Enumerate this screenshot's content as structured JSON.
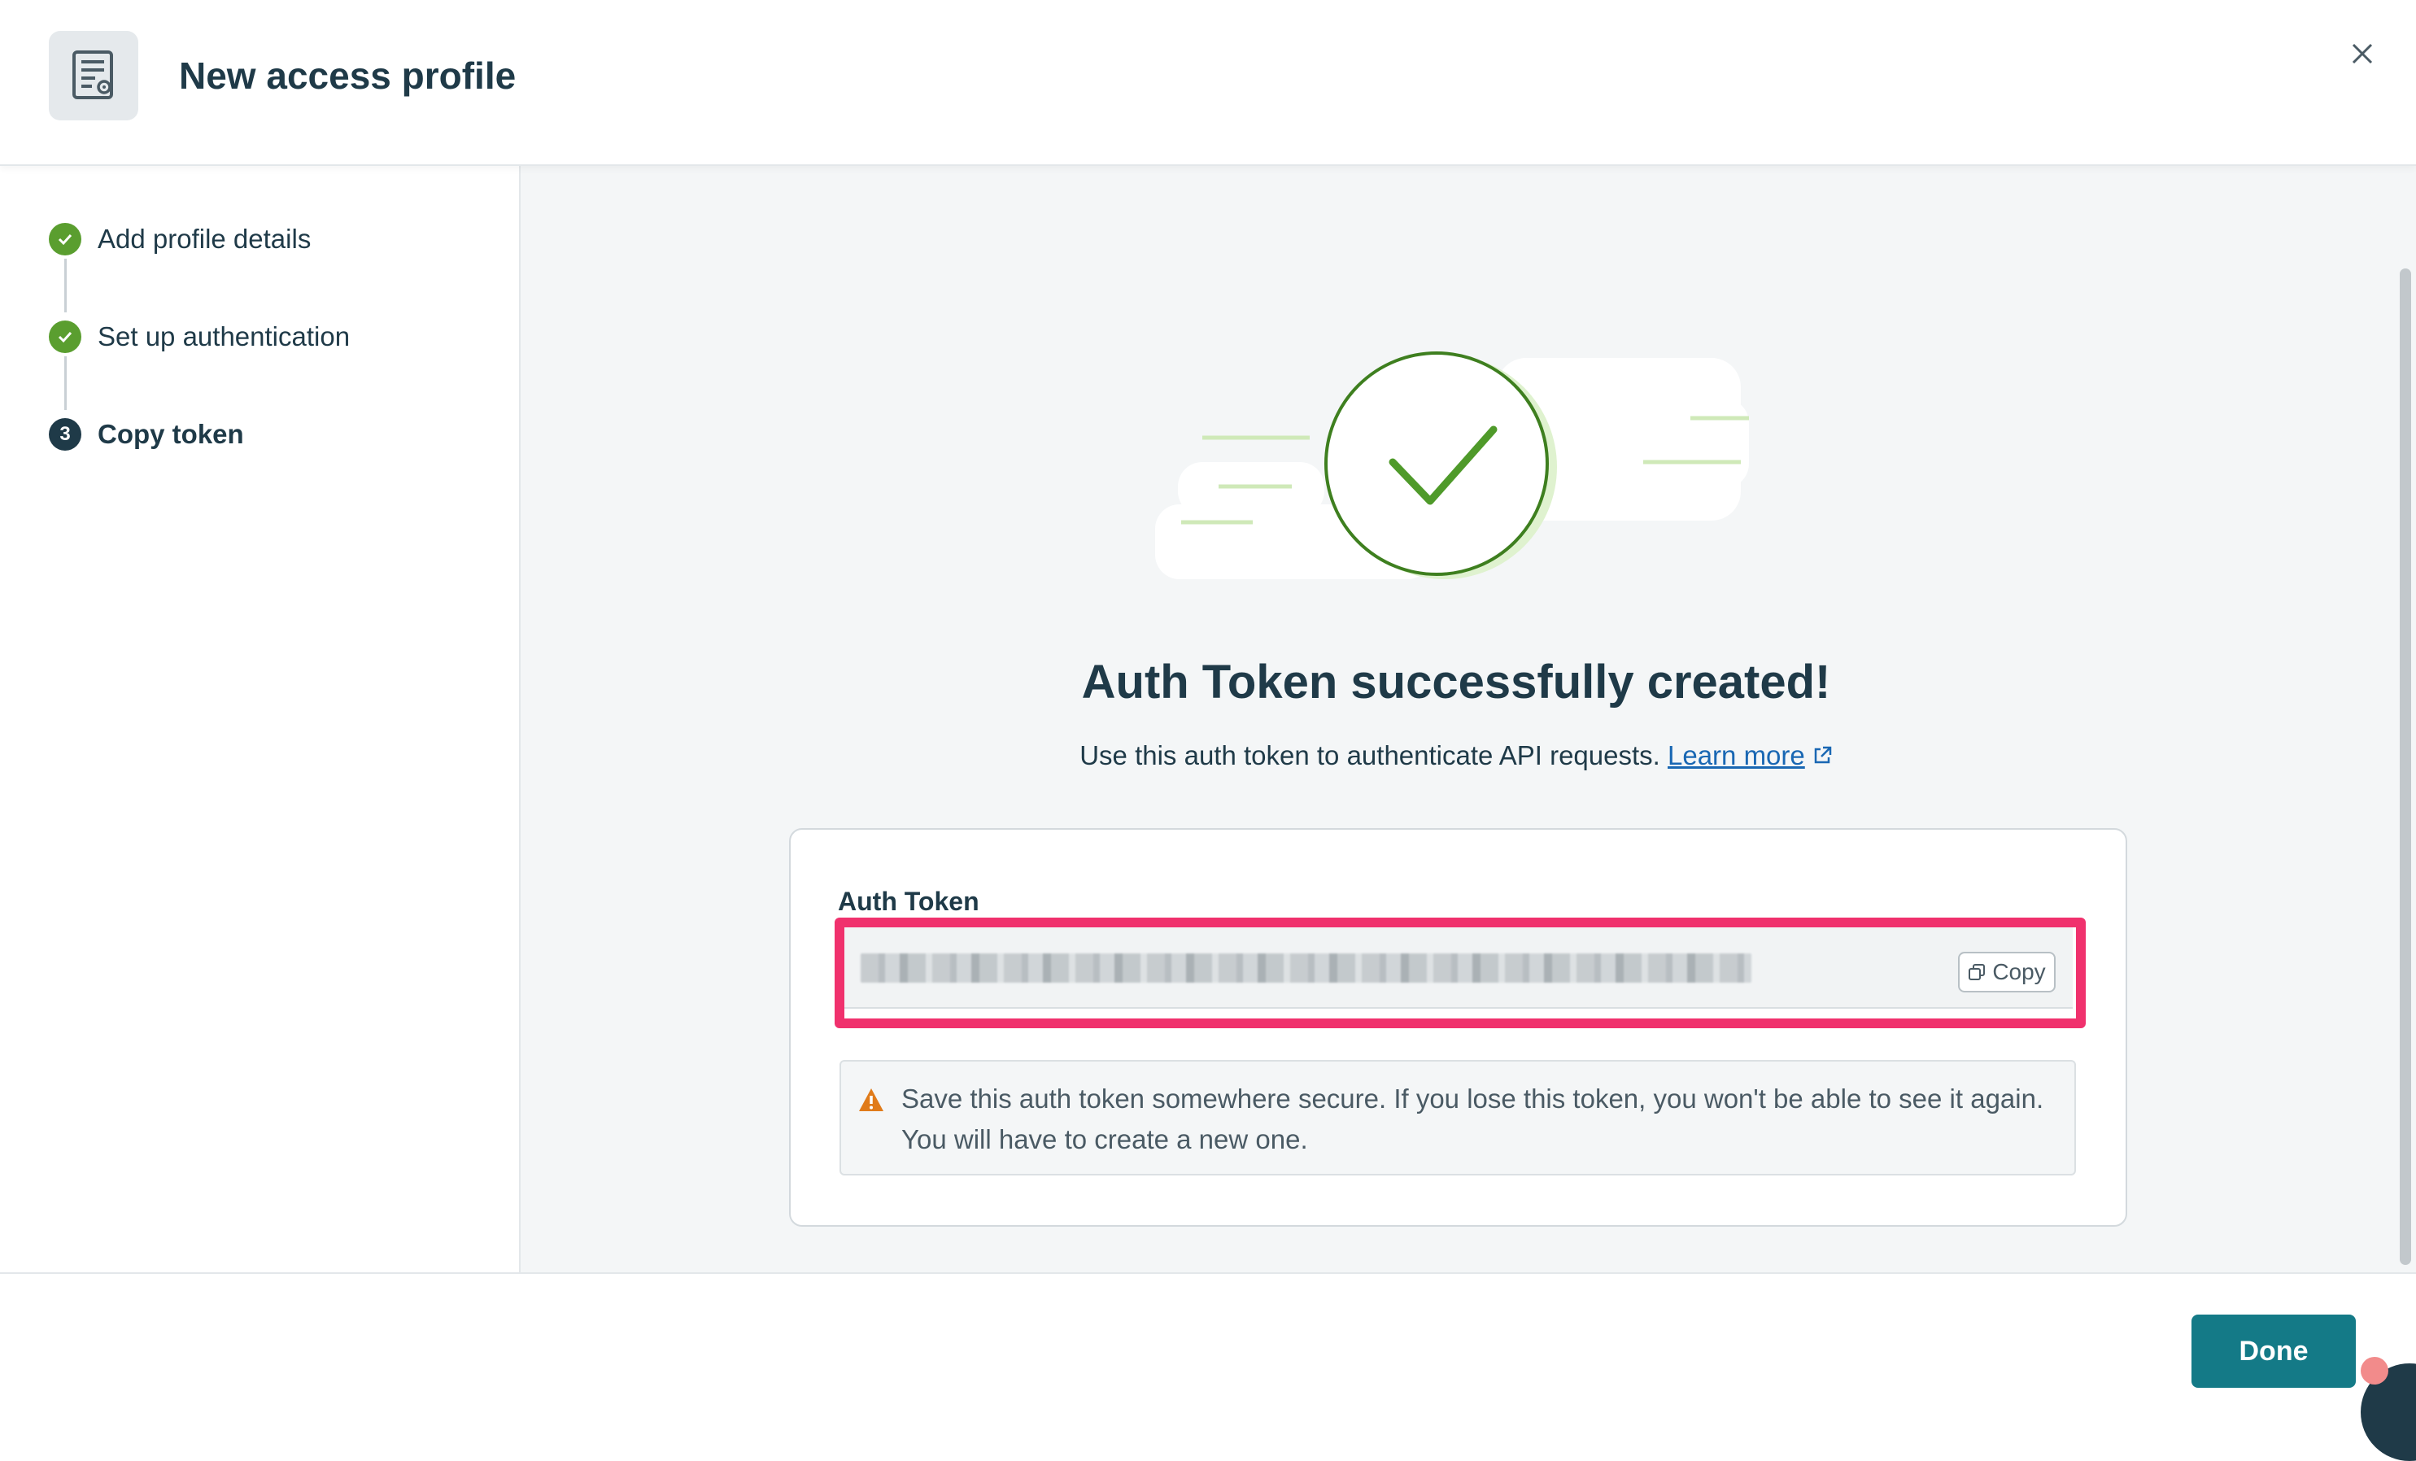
{
  "header": {
    "title": "New access profile",
    "icon": "profile-document-icon",
    "close_icon": "close-icon"
  },
  "steps": [
    {
      "label": "Add profile details",
      "status": "done",
      "marker": ""
    },
    {
      "label": "Set up authentication",
      "status": "done",
      "marker": ""
    },
    {
      "label": "Copy token",
      "status": "active",
      "marker": "3"
    }
  ],
  "main": {
    "title": "Auth Token successfully created!",
    "subtitle": "Use this auth token to authenticate API requests.",
    "learn_more": "Learn more",
    "token_label": "Auth Token",
    "copy_label": "Copy",
    "warning_text": "Save this auth token somewhere secure. If you lose this token, you won't be able to see it again. You will have to create a new one."
  },
  "footer": {
    "done_label": "Done"
  },
  "colors": {
    "success_green": "#5a9e2f",
    "primary_teal": "#147a87",
    "highlight_pink": "#f0316d",
    "warning_orange": "#e07b1a",
    "link_blue": "#1967b3"
  }
}
